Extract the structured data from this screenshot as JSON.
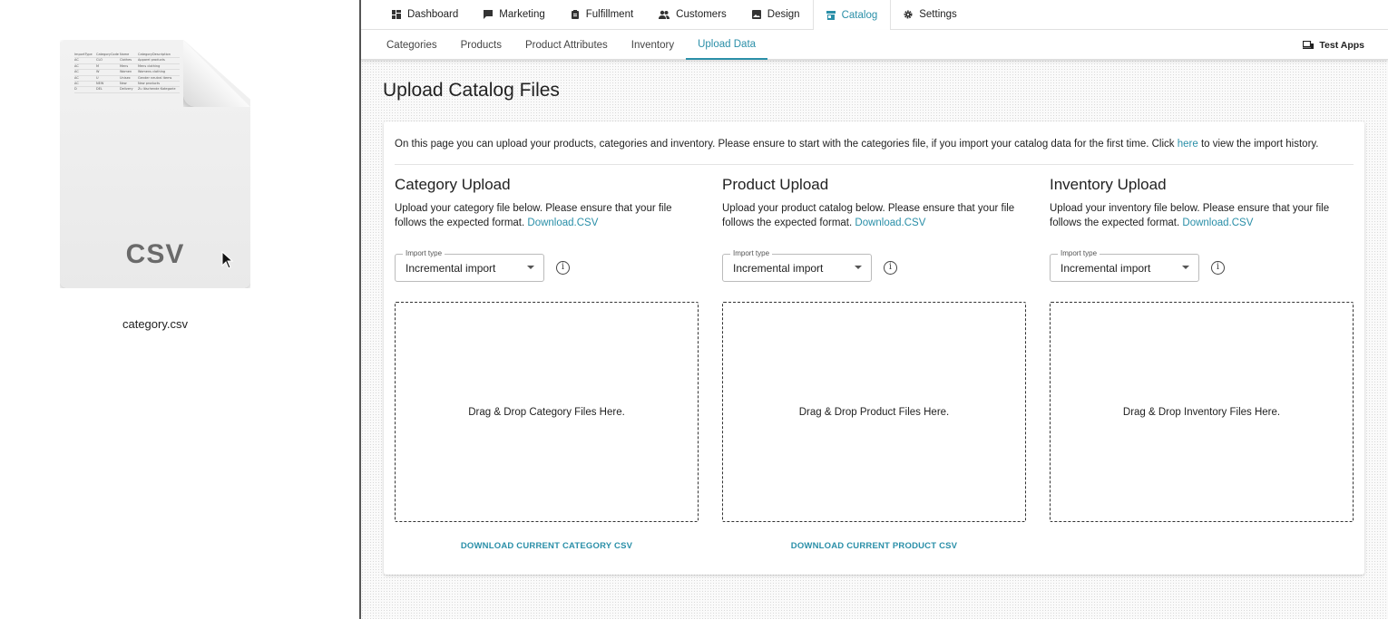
{
  "desktop": {
    "file_name": "category.csv",
    "file_ext": "CSV",
    "preview_rows": [
      [
        "ImportType",
        "CategoryCode",
        "Name",
        "CategoryDescription"
      ],
      [
        "AC",
        "CLO",
        "Clothes",
        "Apparel products"
      ],
      [
        "AC",
        "M",
        "Mens",
        "Mens clothing"
      ],
      [
        "AC",
        "W",
        "Women",
        "Womens clothing"
      ],
      [
        "AC",
        "U",
        "Unisex",
        "Gender neutral items"
      ],
      [
        "AC",
        "NEW",
        "New",
        "New products"
      ],
      [
        "D",
        "DEL",
        "Delivery",
        "Zu löschende Kategorie"
      ]
    ]
  },
  "topnav": {
    "items": [
      {
        "label": "Dashboard",
        "icon": "dashboard-icon"
      },
      {
        "label": "Marketing",
        "icon": "chat-icon"
      },
      {
        "label": "Fulfillment",
        "icon": "clipboard-icon"
      },
      {
        "label": "Customers",
        "icon": "people-icon"
      },
      {
        "label": "Design",
        "icon": "image-icon"
      },
      {
        "label": "Catalog",
        "icon": "store-icon",
        "active": true
      },
      {
        "label": "Settings",
        "icon": "gear-icon"
      }
    ]
  },
  "subnav": {
    "items": [
      {
        "label": "Categories"
      },
      {
        "label": "Products"
      },
      {
        "label": "Product Attributes"
      },
      {
        "label": "Inventory"
      },
      {
        "label": "Upload Data",
        "active": true
      }
    ],
    "test_apps": "Test Apps"
  },
  "page": {
    "title": "Upload Catalog Files",
    "intro_before": "On this page you can upload your products, categories and inventory. Please ensure to start with the categories file, if you import your catalog data for the first time. Click ",
    "intro_link": "here",
    "intro_after": " to view the import history."
  },
  "columns": [
    {
      "title": "Category Upload",
      "desc": "Upload your category file below. Please ensure that your file follows the expected format. ",
      "download_link": "Download.CSV",
      "import_label": "Import type",
      "import_value": "Incremental import",
      "drop_text": "Drag & Drop Category Files Here.",
      "download_current": "DOWNLOAD CURRENT CATEGORY CSV"
    },
    {
      "title": "Product Upload",
      "desc": "Upload your product catalog below. Please ensure that your file follows the expected format. ",
      "download_link": "Download.CSV",
      "import_label": "Import type",
      "import_value": "Incremental import",
      "drop_text": "Drag & Drop Product Files Here.",
      "download_current": "DOWNLOAD CURRENT PRODUCT CSV"
    },
    {
      "title": "Inventory Upload",
      "desc": "Upload your inventory file below. Please ensure that your file follows the expected format. ",
      "download_link": "Download.CSV",
      "import_label": "Import type",
      "import_value": "Incremental import",
      "drop_text": "Drag & Drop Inventory Files Here.",
      "download_current": ""
    }
  ],
  "colors": {
    "accent": "#2a8fa8",
    "text": "#222222",
    "border": "#bbbbbb"
  }
}
